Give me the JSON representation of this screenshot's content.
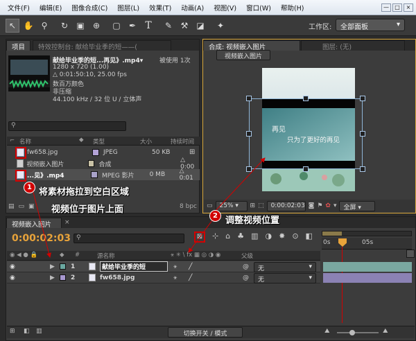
{
  "menu": [
    "文件(F)",
    "编辑(E)",
    "图像合成(C)",
    "图层(L)",
    "效果(T)",
    "动画(A)",
    "视图(V)",
    "窗口(W)",
    "帮助(H)"
  ],
  "window_buttons": [
    "—",
    "□",
    "×"
  ],
  "toolbar": {
    "tools": [
      "selection-tool",
      "hand-tool",
      "zoom-tool",
      "rotate-tool",
      "camera-tool",
      "pan-behind-tool",
      "rectangle-tool",
      "pen-tool",
      "text-tool",
      "brush-tool",
      "clone-stamp-tool",
      "eraser-tool",
      "puppet-tool"
    ],
    "workspace_label": "工作区:",
    "workspace_value": "全部面板"
  },
  "project_panel": {
    "tab_project": "项目",
    "tab_effects": "特效控制台: 献给毕业季的短——(",
    "selected_title": "献给毕业季的短...再见》.mp4▾",
    "usage": "被使用 1次",
    "info": [
      "1280 x 720 (1.00)",
      "△ 0:01:50:10, 25.00 fps",
      "数百万颜色",
      "非压缩",
      "44.100 kHz / 32 位 U / 立体声"
    ],
    "columns": [
      "名称",
      "类型",
      "大小",
      "持续时间"
    ],
    "items": [
      {
        "name": "fw658.jpg",
        "type": "JPEG",
        "size": "50 KB",
        "duration": "",
        "swatch": "#b3a3d6"
      },
      {
        "name": "视频嵌入图片",
        "type": "合成",
        "size": "",
        "duration": "△ 0:00",
        "swatch": "#c9c2a6"
      },
      {
        "name": "...见》.mp4",
        "type": "MPEG 影片",
        "size": "0 MB",
        "duration": "△ 0:01",
        "swatch": "#a8a2c8"
      }
    ],
    "bpc": "8 bpc"
  },
  "composition_panel": {
    "tab_comp": "合成: 视频嵌入图片",
    "tab_layer": "图层: (无)",
    "comp_name_button": "视频嵌入图片",
    "overlay_text_1": "再见",
    "overlay_text_2": "只为了更好的再见",
    "zoom": "25%",
    "timecode": "0:00:02:03",
    "resolution": "全屏"
  },
  "timeline": {
    "tab_label": "视频嵌入图片",
    "timecode": "0:00:02:03",
    "col_source": "源名称",
    "col_parent": "父级",
    "ruler": [
      "0s",
      "05s"
    ],
    "layers": [
      {
        "num": "1",
        "name": "献给毕业季的短",
        "parent": "无",
        "swatch": "#6aa8a0"
      },
      {
        "num": "2",
        "name": "fw658.jpg",
        "parent": "无",
        "swatch": "#a898d0"
      }
    ],
    "footer_button": "切换开关 / 模式"
  },
  "annotations": {
    "step1_num": "1",
    "step1_line1": "将素材拖拉到空白区域",
    "step1_line2": "视频位于图片上面",
    "step2_num": "2",
    "step2_text": "调整视频位置"
  },
  "colors": {
    "annotation_red": "#d40000",
    "accent_orange": "#e8a33a"
  }
}
